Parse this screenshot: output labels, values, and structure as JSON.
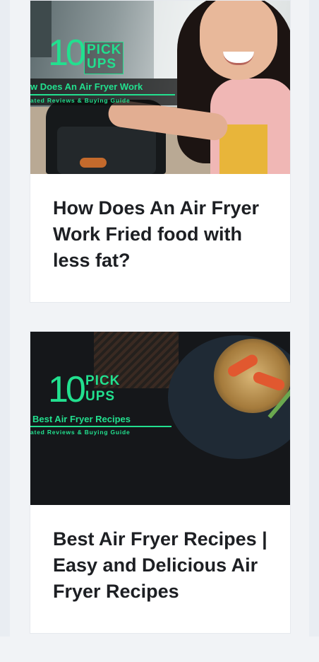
{
  "articles": [
    {
      "title": "How Does An Air Fryer Work Fried food with less fat?",
      "image": {
        "brand_number": "10",
        "brand_word_top": "PICK",
        "brand_word_bottom": "UPS",
        "headline": "w Does An Air Fryer Work",
        "tagline": "ated Reviews & Buying Guide"
      }
    },
    {
      "title": "Best Air Fryer Recipes | Easy and Delicious Air Fryer Recipes",
      "image": {
        "brand_number": "10",
        "brand_word_top": "PICK",
        "brand_word_bottom": "UPS",
        "headline": "Best Air Fryer Recipes",
        "tagline": "ated Reviews & Buying Guide"
      }
    }
  ],
  "colors": {
    "brand_green": "#22e08f",
    "card_bg": "#ffffff",
    "page_bg": "#f1f3f6",
    "title_text": "#1d1f23"
  }
}
